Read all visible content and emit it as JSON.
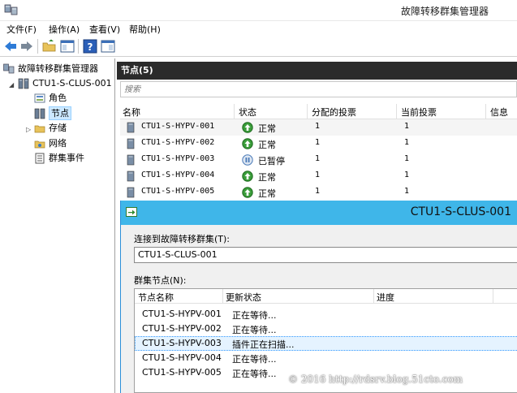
{
  "window": {
    "title": "故障转移群集管理器"
  },
  "menu": [
    "文件(F)",
    "操作(A)",
    "查看(V)",
    "帮助(H)"
  ],
  "tree": {
    "root": "故障转移群集管理器",
    "cluster": "CTU1-S-CLUS-001",
    "items": [
      "角色",
      "节点",
      "存储",
      "网络",
      "群集事件"
    ]
  },
  "nodes_panel": {
    "header": "节点(5)",
    "search_placeholder": "搜索",
    "columns": [
      "名称",
      "状态",
      "分配的投票",
      "当前投票",
      "信息"
    ],
    "rows": [
      {
        "name": "CTU1-S-HYPV-001",
        "status": "正常",
        "assigned": "1",
        "current": "1",
        "state": "up"
      },
      {
        "name": "CTU1-S-HYPV-002",
        "status": "正常",
        "assigned": "1",
        "current": "1",
        "state": "up"
      },
      {
        "name": "CTU1-S-HYPV-003",
        "status": "已暂停",
        "assigned": "1",
        "current": "1",
        "state": "paused"
      },
      {
        "name": "CTU1-S-HYPV-004",
        "status": "正常",
        "assigned": "1",
        "current": "1",
        "state": "up"
      },
      {
        "name": "CTU1-S-HYPV-005",
        "status": "正常",
        "assigned": "1",
        "current": "1",
        "state": "up"
      }
    ]
  },
  "dialog": {
    "title": "CTU1-S-CLUS-001",
    "connect_label": "连接到故障转移群集(T):",
    "connect_value": "CTU1-S-CLUS-001",
    "nodes_label": "群集节点(N):",
    "columns": [
      "节点名称",
      "更新状态",
      "进度"
    ],
    "rows": [
      {
        "name": "CTU1-S-HYPV-001",
        "status": "正在等待..."
      },
      {
        "name": "CTU1-S-HYPV-002",
        "status": "正在等待..."
      },
      {
        "name": "CTU1-S-HYPV-003",
        "status": "插件正在扫描..."
      },
      {
        "name": "CTU1-S-HYPV-004",
        "status": "正在等待..."
      },
      {
        "name": "CTU1-S-HYPV-005",
        "status": "正在等待..."
      }
    ],
    "selected_row": 2
  },
  "watermark": "© 2016 http://rdsrv.blog.51cto.com",
  "colors": {
    "accent": "#3fb6e9",
    "header_dark": "#2b2b2b",
    "status_green": "#3a9d3a",
    "status_paused": "#4a7ab8"
  }
}
